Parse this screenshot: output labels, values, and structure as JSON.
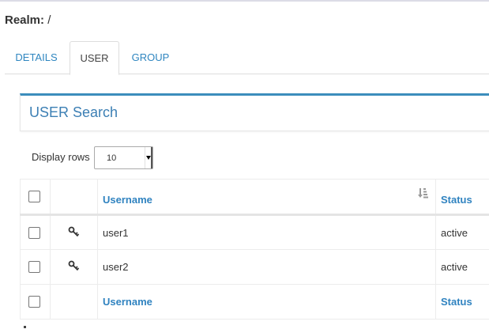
{
  "realm": {
    "label": "Realm:",
    "value": "/"
  },
  "tabs": [
    {
      "label": "DETAILS",
      "active": false
    },
    {
      "label": "USER",
      "active": true
    },
    {
      "label": "GROUP",
      "active": false
    }
  ],
  "panel": {
    "title": "USER Search"
  },
  "display_rows": {
    "label": "Display rows",
    "value": "10"
  },
  "table": {
    "headers": {
      "username": "Username",
      "status": "Status"
    },
    "rows": [
      {
        "username": "user1",
        "status": "active",
        "icon": "key-icon"
      },
      {
        "username": "user2",
        "status": "active",
        "icon": "key-icon"
      }
    ],
    "footer": {
      "username": "Username",
      "status": "Status"
    }
  },
  "colors": {
    "accent": "#3c8dbc",
    "link": "#2f86c0"
  }
}
